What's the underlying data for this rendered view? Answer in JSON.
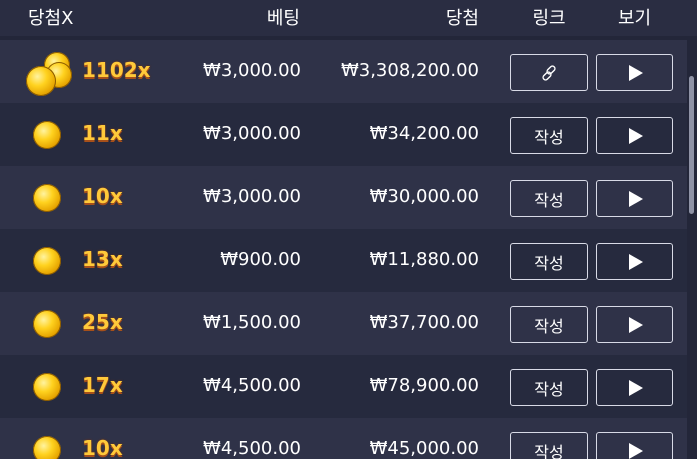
{
  "header": {
    "multiplier": "당첨X",
    "bet": "베팅",
    "win": "당첨",
    "link": "링크",
    "view": "보기"
  },
  "rows": [
    {
      "multiplier": "1102x",
      "bet": "₩3,000.00",
      "win": "₩3,308,200.00",
      "link_label": "",
      "link_icon": "chain-link-icon"
    },
    {
      "multiplier": "11x",
      "bet": "₩3,000.00",
      "win": "₩34,200.00",
      "link_label": "작성"
    },
    {
      "multiplier": "10x",
      "bet": "₩3,000.00",
      "win": "₩30,000.00",
      "link_label": "작성"
    },
    {
      "multiplier": "13x",
      "bet": "₩900.00",
      "win": "₩11,880.00",
      "link_label": "작성"
    },
    {
      "multiplier": "25x",
      "bet": "₩1,500.00",
      "win": "₩37,700.00",
      "link_label": "작성"
    },
    {
      "multiplier": "17x",
      "bet": "₩4,500.00",
      "win": "₩78,900.00",
      "link_label": "작성"
    },
    {
      "multiplier": "10x",
      "bet": "₩4,500.00",
      "win": "₩45,000.00",
      "link_label": "작성"
    }
  ],
  "colors": {
    "background": "#232639",
    "row_odd": "#2f3248",
    "row_even": "#262a3e",
    "multiplier_text": "#ffc93a"
  }
}
